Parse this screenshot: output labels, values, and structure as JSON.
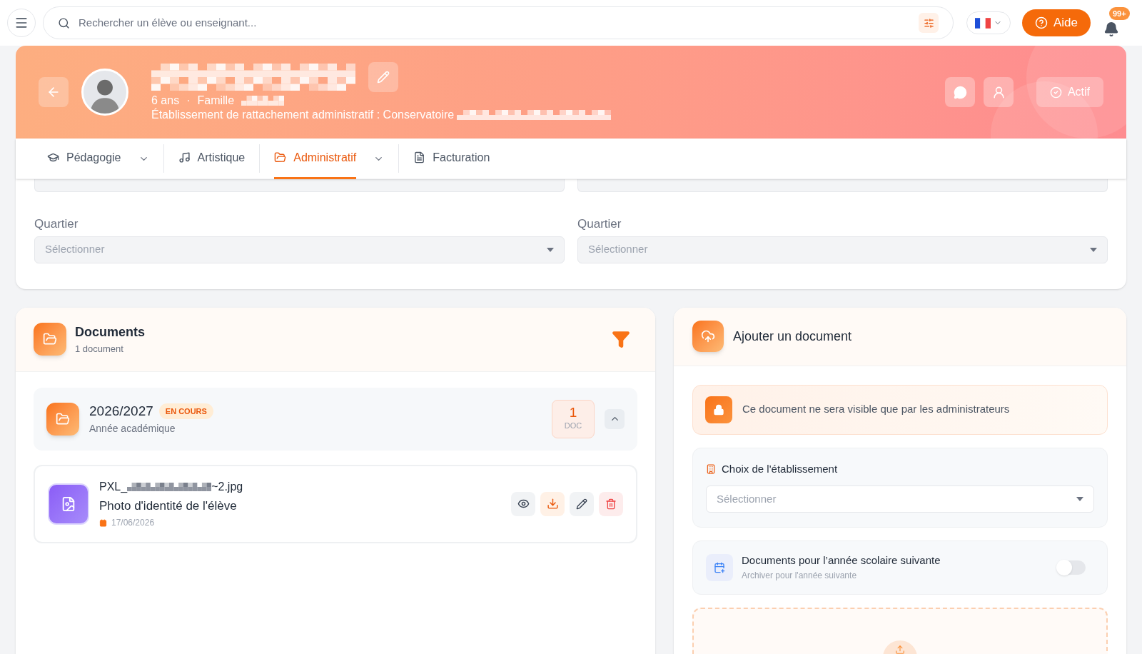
{
  "topbar": {
    "search_placeholder": "Rechercher un élève ou enseignant...",
    "help_button": "Aide",
    "notification_badge": "99+"
  },
  "profile": {
    "age": "6 ans",
    "separator": "·",
    "family_label": "Famille",
    "establishment_label": "Établissement de rattachement administratif : Conservatoire",
    "status": "Actif"
  },
  "tabs": [
    {
      "label": "Pédagogie",
      "selected": false,
      "dropdown": true
    },
    {
      "label": "Artistique",
      "selected": false,
      "dropdown": false
    },
    {
      "label": "Administratif",
      "selected": true,
      "dropdown": true
    },
    {
      "label": "Facturation",
      "selected": false,
      "dropdown": false
    }
  ],
  "address_fields": [
    {
      "label": "Quartier",
      "placeholder": "Sélectionner"
    },
    {
      "label": "Quartier",
      "placeholder": "Sélectionner"
    }
  ],
  "documents": {
    "title": "Documents",
    "count": "1 document",
    "years": [
      {
        "year": "2026/2027",
        "badge": "EN COURS",
        "subtitle": "Année académique",
        "doc_count": "1",
        "doc_unit": "DOC",
        "expanded": true,
        "files": [
          {
            "name_prefix": "PXL_",
            "name_suffix": "~2.jpg",
            "title": "Photo d'identité de l'élève",
            "date": "17/06/2026"
          }
        ]
      }
    ]
  },
  "upload": {
    "title": "Ajouter un document",
    "notice": "Ce document ne sera visible que par les administrateurs",
    "establishment": {
      "label": "Choix de l'établissement",
      "placeholder": "Sélectionner"
    },
    "next_year": {
      "title": "Documents pour l’année scolaire suivante",
      "subtitle": "Archiver pour l'année suivante",
      "on": false
    }
  }
}
